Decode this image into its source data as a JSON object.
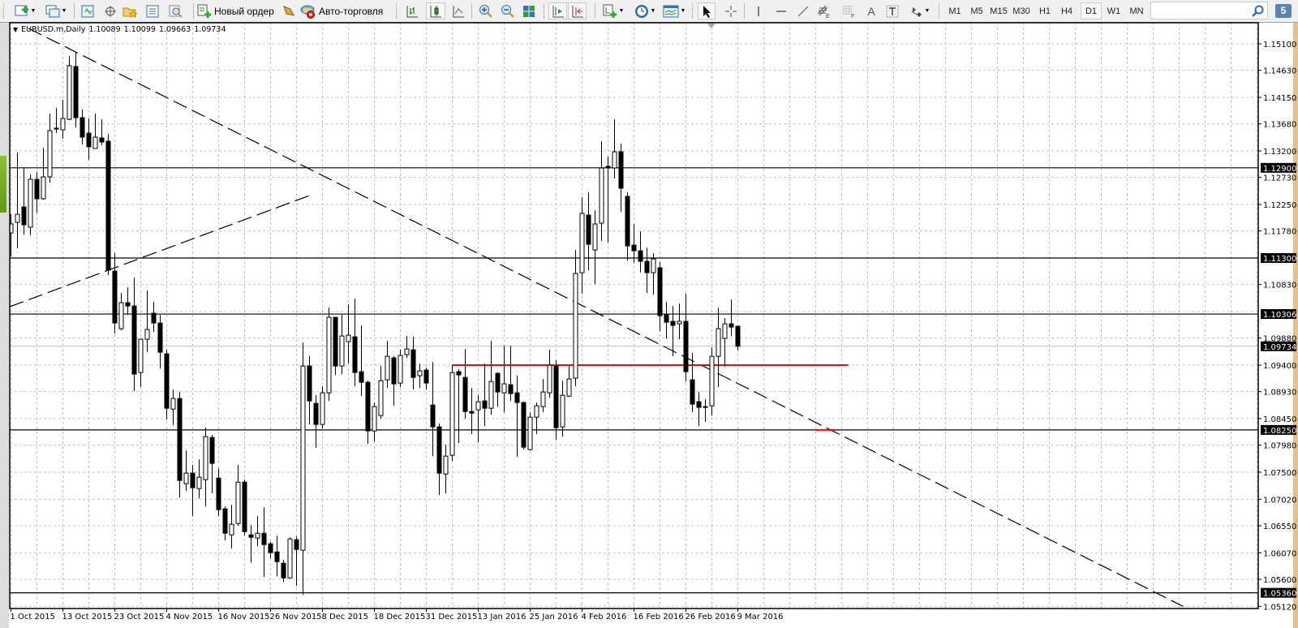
{
  "toolbar": {
    "new_order_label": "Новый ордер",
    "autotrading_label": "Авто-торговля",
    "timeframes": [
      "M1",
      "M5",
      "M15",
      "M30",
      "H1",
      "H4",
      "D1",
      "W1",
      "MN"
    ],
    "active_timeframe": "D1",
    "notification_count": "5",
    "search_value": ""
  },
  "chart_header": {
    "symbol": "EURUSD.m,Daily",
    "open": "1.10089",
    "high": "1.10099",
    "low": "1.09663",
    "close": "1.09734"
  },
  "chart_data": {
    "type": "candlestick",
    "symbol": "EURUSD.m",
    "timeframe": "Daily",
    "ylim": [
      1.0512,
      1.151
    ],
    "price_ticks": [
      "1.15100",
      "1.14630",
      "1.14150",
      "1.13680",
      "1.13200",
      "1.12730",
      "1.12250",
      "1.11780",
      "1.10830",
      "1.09880",
      "1.09400",
      "1.08930",
      "1.08450",
      "1.07980",
      "1.07500",
      "1.07020",
      "1.06550",
      "1.06070",
      "1.05600",
      "1.05120"
    ],
    "x_labels": [
      {
        "bar": 0,
        "text": "1 Oct 2015"
      },
      {
        "bar": 8,
        "text": "13 Oct 2015"
      },
      {
        "bar": 16,
        "text": "23 Oct 2015"
      },
      {
        "bar": 24,
        "text": "4 Nov 2015"
      },
      {
        "bar": 32,
        "text": "16 Nov 2015"
      },
      {
        "bar": 40,
        "text": "26 Nov 2015"
      },
      {
        "bar": 48,
        "text": "8 Dec 2015"
      },
      {
        "bar": 56,
        "text": "18 Dec 2015"
      },
      {
        "bar": 64,
        "text": "31 Dec 2015"
      },
      {
        "bar": 72,
        "text": "13 Jan 2016"
      },
      {
        "bar": 80,
        "text": "25 Jan 2016"
      },
      {
        "bar": 88,
        "text": "4 Feb 2016"
      },
      {
        "bar": 96,
        "text": "16 Feb 2016"
      },
      {
        "bar": 104,
        "text": "26 Feb 2016"
      },
      {
        "bar": 112,
        "text": "9 Mar 2016"
      }
    ],
    "horizontal_lines": [
      {
        "price": 1.129,
        "label": "1.12900",
        "color": "#000000"
      },
      {
        "price": 1.113,
        "label": "1.11300",
        "color": "#000000"
      },
      {
        "price": 1.10306,
        "label": "1.10306",
        "color": "#000000"
      },
      {
        "price": 1.0825,
        "label": "1.08250",
        "color": "#000000"
      },
      {
        "price": 1.0536,
        "label": "1.05360",
        "color": "#000000"
      }
    ],
    "bid_line": {
      "price": 1.09734,
      "label": "1.09734",
      "color": "#c0c0c0"
    },
    "trendlines": [
      {
        "name": "downtrend",
        "from": [
          2.7,
          1.15374
        ],
        "to": [
          180.6,
          1.0512
        ],
        "style": "dashed",
        "color": "#000000"
      },
      {
        "name": "uptrend",
        "from": [
          -0.2,
          1.10435
        ],
        "to": [
          46,
          1.12408
        ],
        "style": "dashed",
        "color": "#000000"
      },
      {
        "name": "red-level",
        "from": [
          68,
          1.094
        ],
        "to": [
          129,
          1.094
        ],
        "style": "solid",
        "color": "#ff0000"
      },
      {
        "name": "red-mark",
        "from": [
          124,
          1.0825
        ],
        "to": [
          127,
          1.0825
        ],
        "style": "solid",
        "color": "#ff0000"
      }
    ],
    "candles_ohlc": [
      [
        1.11745,
        1.12076,
        1.11328,
        1.11904
      ],
      [
        1.11932,
        1.13171,
        1.11472,
        1.12076
      ],
      [
        1.12206,
        1.12897,
        1.11716,
        1.11889
      ],
      [
        1.11846,
        1.12782,
        1.11702,
        1.12696
      ],
      [
        1.12696,
        1.12825,
        1.12105,
        1.1235
      ],
      [
        1.1235,
        1.13257,
        1.12336,
        1.12739
      ],
      [
        1.12739,
        1.13862,
        1.12638,
        1.1356
      ],
      [
        1.13588,
        1.13963,
        1.13516,
        1.13603
      ],
      [
        1.13574,
        1.14107,
        1.13416,
        1.13776
      ],
      [
        1.13761,
        1.14884,
        1.13747,
        1.14712
      ],
      [
        1.14697,
        1.14942,
        1.13617,
        1.1379
      ],
      [
        1.1379,
        1.13934,
        1.13315,
        1.13444
      ],
      [
        1.13516,
        1.13776,
        1.13041,
        1.13272
      ],
      [
        1.13243,
        1.13862,
        1.13243,
        1.13444
      ],
      [
        1.1343,
        1.13761,
        1.133,
        1.13358
      ],
      [
        1.13372,
        1.13502,
        1.10996,
        1.11083
      ],
      [
        1.11068,
        1.11385,
        1.0996,
        1.10147
      ],
      [
        1.10046,
        1.1068,
        1.10017,
        1.10507
      ],
      [
        1.10507,
        1.1078,
        1.10291,
        1.10449
      ],
      [
        1.10449,
        1.10953,
        1.08937,
        1.0924
      ],
      [
        1.09268,
        1.09859,
        1.09009,
        1.09859
      ],
      [
        1.09859,
        1.10723,
        1.09628,
        1.10032
      ],
      [
        1.1032,
        1.10521,
        1.09988,
        1.10147
      ],
      [
        1.10147,
        1.10291,
        1.0934,
        1.09628
      ],
      [
        1.096,
        1.09672,
        1.08433,
        1.08635
      ],
      [
        1.0862,
        1.08966,
        1.08332,
        1.08808
      ],
      [
        1.08808,
        1.08923,
        1.07051,
        1.07353
      ],
      [
        1.07296,
        1.07886,
        1.07166,
        1.07483
      ],
      [
        1.07483,
        1.07627,
        1.0672,
        1.07224
      ],
      [
        1.07209,
        1.07728,
        1.07036,
        1.07411
      ],
      [
        1.07368,
        1.08289,
        1.06892,
        1.08131
      ],
      [
        1.08116,
        1.0816,
        1.07123,
        1.07656
      ],
      [
        1.07396,
        1.07569,
        1.0672,
        1.06835
      ],
      [
        1.06849,
        1.06892,
        1.06288,
        1.06417
      ],
      [
        1.06388,
        1.06921,
        1.06144,
        1.06576
      ],
      [
        1.0659,
        1.07627,
        1.06547,
        1.07324
      ],
      [
        1.07324,
        1.07368,
        1.06374,
        1.06446
      ],
      [
        1.06388,
        1.06561,
        1.05899,
        1.06345
      ],
      [
        1.06331,
        1.0672,
        1.06187,
        1.06417
      ],
      [
        1.06417,
        1.06878,
        1.0564,
        1.06216
      ],
      [
        1.0623,
        1.06259,
        1.05971,
        1.06072
      ],
      [
        1.06086,
        1.06374,
        1.05654,
        1.05913
      ],
      [
        1.05884,
        1.05942,
        1.05553,
        1.05625
      ],
      [
        1.05625,
        1.06345,
        1.05611,
        1.06316
      ],
      [
        1.06302,
        1.0636,
        1.05481,
        1.06129
      ],
      [
        1.06115,
        1.09801,
        1.05323,
        1.09384
      ],
      [
        1.09384,
        1.09556,
        1.08347,
        1.08764
      ],
      [
        1.08721,
        1.08865,
        1.07929,
        1.08347
      ],
      [
        1.08347,
        1.09024,
        1.08275,
        1.08908
      ],
      [
        1.08908,
        1.1042,
        1.08764,
        1.10248
      ],
      [
        1.10248,
        1.10248,
        1.09225,
        1.09384
      ],
      [
        1.09384,
        1.10305,
        1.0924,
        1.09916
      ],
      [
        1.09816,
        1.10478,
        1.09427,
        1.09931
      ],
      [
        1.09902,
        1.10579,
        1.09024,
        1.09268
      ],
      [
        1.09283,
        1.10104,
        1.08851,
        1.09096
      ],
      [
        1.09096,
        1.09124,
        1.08001,
        1.08232
      ],
      [
        1.08232,
        1.08736,
        1.08044,
        1.08664
      ],
      [
        1.08505,
        1.09384,
        1.08448,
        1.09124
      ],
      [
        1.09139,
        1.0983,
        1.08995,
        1.09556
      ],
      [
        1.09528,
        1.09556,
        1.08678,
        1.09067
      ],
      [
        1.09081,
        1.09672,
        1.09009,
        1.09571
      ],
      [
        1.09585,
        1.09916,
        1.09528,
        1.09686
      ],
      [
        1.09672,
        1.09902,
        1.08966,
        1.09182
      ],
      [
        1.09211,
        1.09427,
        1.08995,
        1.09297
      ],
      [
        1.09312,
        1.09355,
        1.08966,
        1.09081
      ],
      [
        1.08692,
        1.09456,
        1.07785,
        1.08304
      ],
      [
        1.08304,
        1.08361,
        1.07094,
        1.07483
      ],
      [
        1.07468,
        1.07987,
        1.07123,
        1.07785
      ],
      [
        1.078,
        1.09398,
        1.07699,
        1.09268
      ],
      [
        1.09283,
        1.09326,
        1.08016,
        1.09225
      ],
      [
        1.09182,
        1.09686,
        1.08448,
        1.08577
      ],
      [
        1.08577,
        1.08995,
        1.08174,
        1.08548
      ],
      [
        1.08606,
        1.08865,
        1.0803,
        1.0875
      ],
      [
        1.08764,
        1.09427,
        1.08318,
        1.08635
      ],
      [
        1.08635,
        1.0983,
        1.0852,
        1.0911
      ],
      [
        1.09254,
        1.09268,
        1.08664,
        1.08923
      ],
      [
        1.08908,
        1.09744,
        1.08563,
        1.09067
      ],
      [
        1.09052,
        1.09744,
        1.08764,
        1.08894
      ],
      [
        1.08908,
        1.09211,
        1.07771,
        1.08736
      ],
      [
        1.08736,
        1.0875,
        1.079,
        1.07944
      ],
      [
        1.079,
        1.08563,
        1.07886,
        1.08476
      ],
      [
        1.08476,
        1.08736,
        1.08174,
        1.08678
      ],
      [
        1.08664,
        1.09153,
        1.08563,
        1.08923
      ],
      [
        1.08908,
        1.09672,
        1.08822,
        1.09398
      ],
      [
        1.09384,
        1.09484,
        1.08073,
        1.08289
      ],
      [
        1.08304,
        1.09124,
        1.08131,
        1.08865
      ],
      [
        1.0885,
        1.09384,
        1.08836,
        1.09153
      ],
      [
        1.09168,
        1.11443,
        1.09024,
        1.11025
      ],
      [
        1.1104,
        1.12379,
        1.10665,
        1.12091
      ],
      [
        1.12062,
        1.12465,
        1.11083,
        1.11544
      ],
      [
        1.11443,
        1.12148,
        1.10838,
        1.11904
      ],
      [
        1.11918,
        1.13372,
        1.11601,
        1.12897
      ],
      [
        1.12926,
        1.13099,
        1.11572,
        1.12897
      ],
      [
        1.12897,
        1.13761,
        1.1271,
        1.13185
      ],
      [
        1.13185,
        1.13329,
        1.1212,
        1.12537
      ],
      [
        1.12393,
        1.12465,
        1.11256,
        1.11515
      ],
      [
        1.11529,
        1.11904,
        1.11212,
        1.11428
      ],
      [
        1.11428,
        1.11774,
        1.1104,
        1.11241
      ],
      [
        1.11241,
        1.11486,
        1.1068,
        1.1104
      ],
      [
        1.1104,
        1.11385,
        1.10651,
        1.11284
      ],
      [
        1.11126,
        1.11227,
        1.10003,
        1.10276
      ],
      [
        1.10291,
        1.10521,
        1.09873,
        1.10161
      ],
      [
        1.10176,
        1.10449,
        1.09556,
        1.10104
      ],
      [
        1.10132,
        1.10492,
        1.09859,
        1.10176
      ],
      [
        1.10176,
        1.10665,
        1.0911,
        1.09283
      ],
      [
        1.09139,
        1.09614,
        1.08563,
        1.08707
      ],
      [
        1.0875,
        1.08923,
        1.08318,
        1.08649
      ],
      [
        1.08664,
        1.08793,
        1.0839,
        1.08649
      ],
      [
        1.08678,
        1.09715,
        1.08505,
        1.09556
      ],
      [
        1.09556,
        1.1042,
        1.09009,
        1.10046
      ],
      [
        1.09873,
        1.10233,
        1.09369,
        1.10132
      ],
      [
        1.10132,
        1.10564,
        1.09916,
        1.10075
      ],
      [
        1.10089,
        1.10099,
        1.09663,
        1.09734
      ]
    ]
  }
}
